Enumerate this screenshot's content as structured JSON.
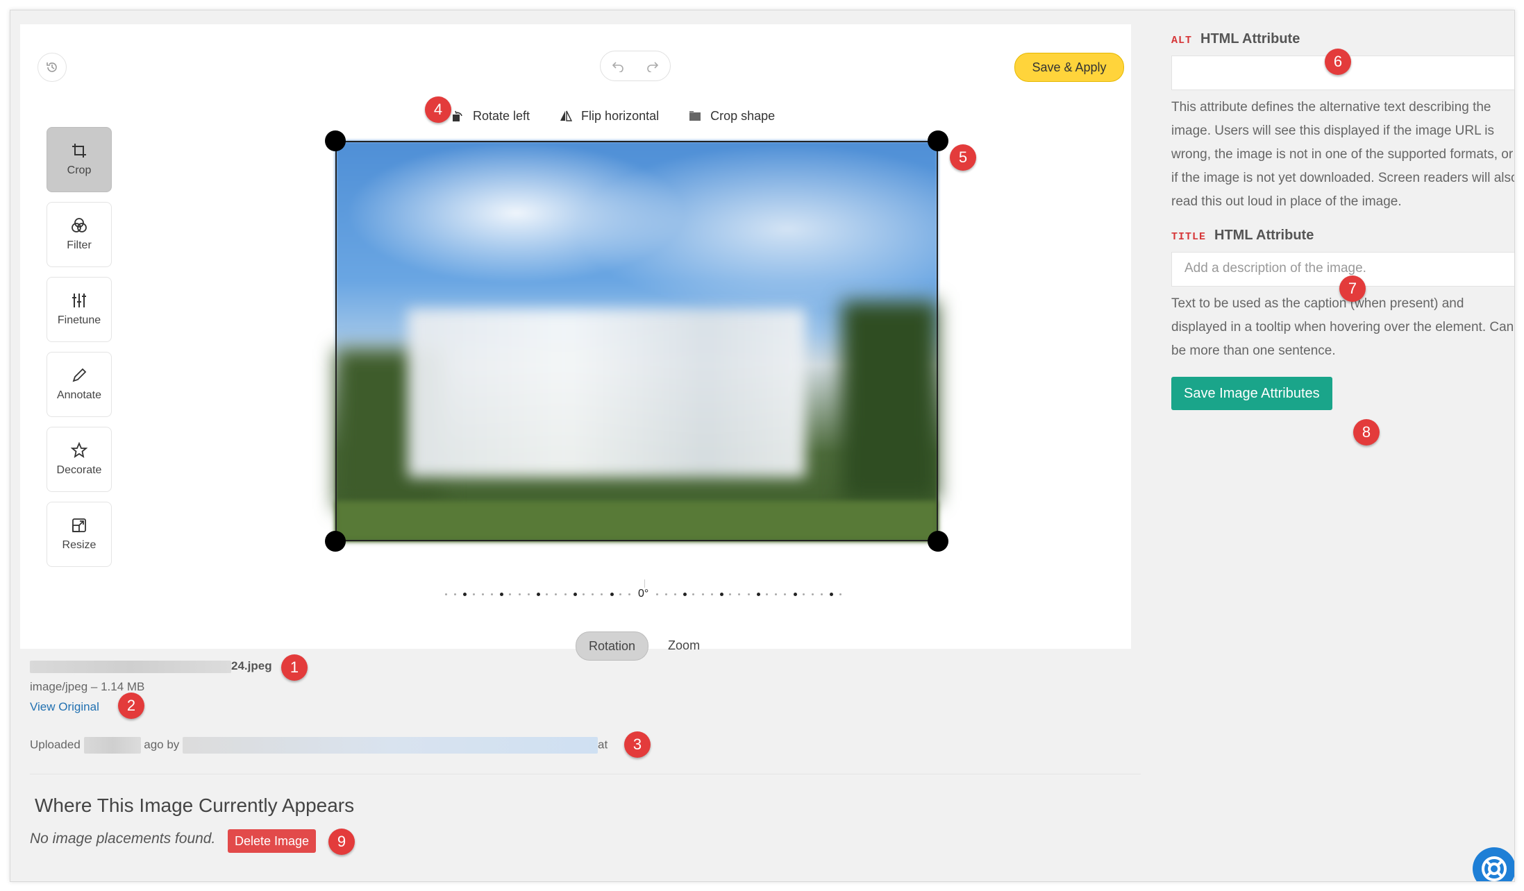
{
  "toolbar": {
    "save_apply": "Save & Apply",
    "rotate_left": "Rotate left",
    "flip_horizontal": "Flip horizontal",
    "crop_shape": "Crop shape"
  },
  "tools": [
    {
      "label": "Crop",
      "icon": "crop-icon"
    },
    {
      "label": "Filter",
      "icon": "filter-icon"
    },
    {
      "label": "Finetune",
      "icon": "sliders-icon"
    },
    {
      "label": "Annotate",
      "icon": "pencil-icon"
    },
    {
      "label": "Decorate",
      "icon": "star-icon"
    },
    {
      "label": "Resize",
      "icon": "resize-icon"
    }
  ],
  "rotation": {
    "value": "0°"
  },
  "modes": {
    "rotation": "Rotation",
    "zoom": "Zoom"
  },
  "file": {
    "name_suffix": "24.jpeg",
    "type_size": "image/jpeg – 1.14 MB",
    "view_original": "View Original",
    "uploaded_prefix": "Uploaded",
    "uploaded_mid": "ago by",
    "uploaded_suffix": "at"
  },
  "where": {
    "title": "Where This Image Currently Appears",
    "none_found": "No image placements found.",
    "delete": "Delete Image"
  },
  "alt": {
    "tag": "ALT",
    "heading": "HTML Attribute",
    "value": "",
    "description": "This attribute defines the alternative text describing the image. Users will see this displayed if the image URL is wrong, the image is not in one of the supported formats, or if the image is not yet downloaded. Screen readers will also read this out loud in place of the image."
  },
  "title_attr": {
    "tag": "TITLE",
    "heading": "HTML Attribute",
    "placeholder": "Add a description of the image.",
    "description": "Text to be used as the caption (when present) and displayed in a tooltip when hovering over the element. Can be more than one sentence."
  },
  "save_attrs": "Save Image Attributes",
  "markers": [
    "1",
    "2",
    "3",
    "4",
    "5",
    "6",
    "7",
    "8",
    "9"
  ],
  "colors": {
    "accent_yellow": "#ffd43b",
    "save_green": "#1aa58a",
    "delete_red": "#e24a4a",
    "marker_red": "#e33b3b",
    "link_blue": "#2271b1"
  }
}
